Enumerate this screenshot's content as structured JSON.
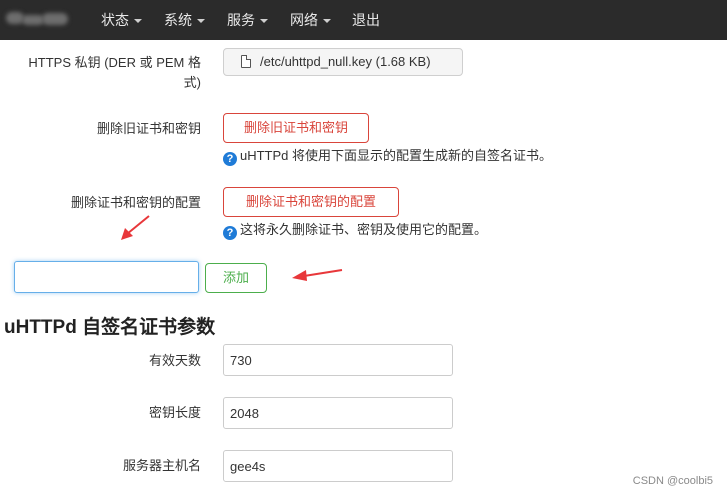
{
  "nav": {
    "items": [
      {
        "label": "状态",
        "dropdown": true
      },
      {
        "label": "系统",
        "dropdown": true
      },
      {
        "label": "服务",
        "dropdown": true
      },
      {
        "label": "网络",
        "dropdown": true
      },
      {
        "label": "退出",
        "dropdown": false
      }
    ]
  },
  "form": {
    "https_key": {
      "label_line1": "HTTPS 私钥 (DER 或 PEM 格",
      "label_line2": "式)",
      "file_label": "/etc/uhttpd_null.key (1.68 KB)"
    },
    "remove_old": {
      "label": "删除旧证书和密钥",
      "button": "删除旧证书和密钥",
      "help": "uHTTPd 将使用下面显示的配置生成新的自签名证书。"
    },
    "remove_config": {
      "label": "删除证书和密钥的配置",
      "button": "删除证书和密钥的配置",
      "help": "这将永久删除证书、密钥及使用它的配置。"
    },
    "add": {
      "input_value": "",
      "button": "添加"
    }
  },
  "section": {
    "title": "uHTTPd 自签名证书参数",
    "fields": [
      {
        "label": "有效天数",
        "value": "730"
      },
      {
        "label": "密钥长度",
        "value": "2048"
      },
      {
        "label": "服务器主机名",
        "value": "gee4s"
      }
    ]
  },
  "colors": {
    "navbar": "#2b2b2b",
    "danger": "#d9453b",
    "success": "#4cae4c",
    "info_icon": "#1f7bd7",
    "annotation_arrow": "#e8373a"
  },
  "watermark": "CSDN @coolbi5"
}
